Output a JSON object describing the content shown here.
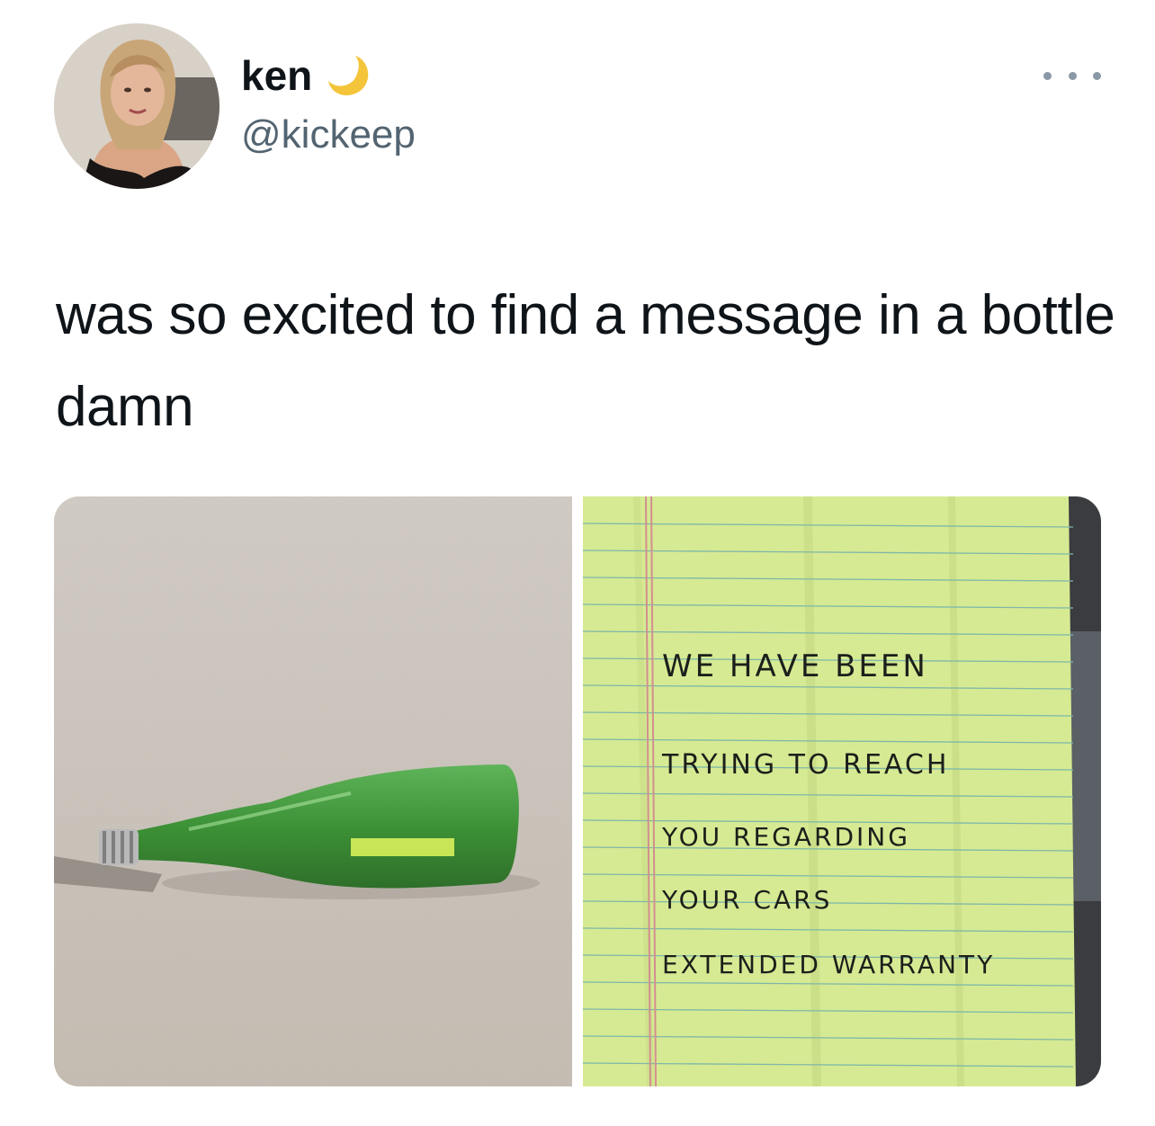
{
  "author": {
    "display_name": "ken",
    "handle": "@kickeep",
    "name_emoji": "crescent-moon-icon"
  },
  "tweet": {
    "text": "was so excited to find a message in a bottle damn"
  },
  "media": [
    {
      "name": "bottle-on-sand-photo",
      "description_icon": "photo"
    },
    {
      "name": "handwritten-note-photo",
      "note_lines": [
        "WE HAVE BEEN",
        "TRYING TO REACH",
        "YOU REGARDING",
        "YOUR CARS",
        "EXTENDED WARRANTY"
      ]
    }
  ],
  "colors": {
    "text": "#0f1419",
    "secondary": "#536471",
    "moon": "#f4c53a",
    "paper": "#d9ec96",
    "sand": "#cfc9c1",
    "bottle": "#3f9a3a"
  }
}
